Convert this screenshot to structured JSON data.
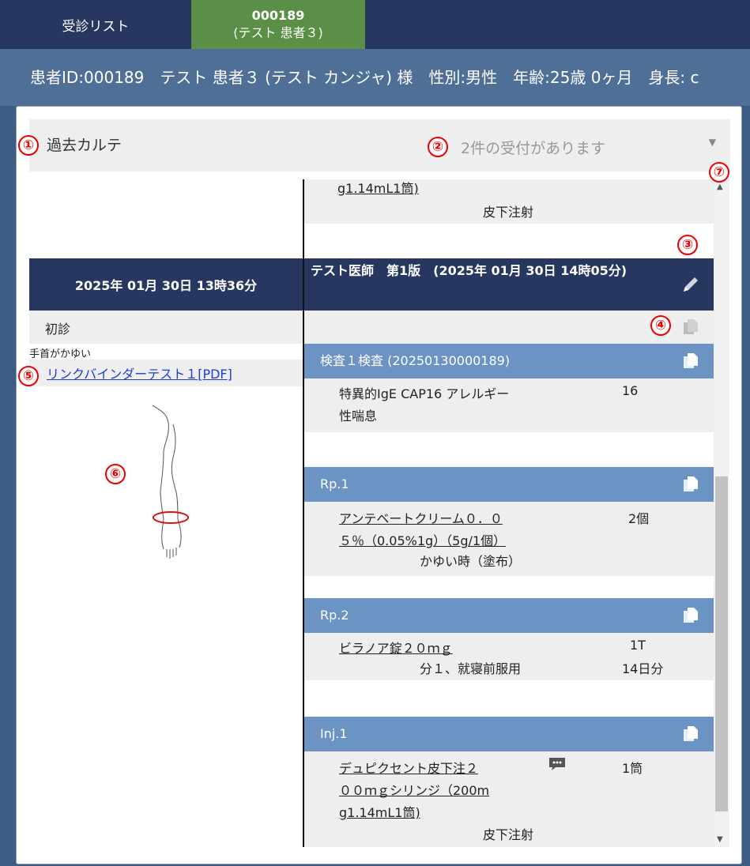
{
  "tabs": {
    "list_label": "受診リスト",
    "active_id": "000189",
    "active_name": "(テスト 患者３)"
  },
  "patient_info": "患者ID:000189　テスト 患者３ (テスト カンジャ) 様　性別:男性　年齢:25歳 0ヶ月　身長: c",
  "select": {
    "title": "過去カルテ",
    "placeholder": "2件の受付があります"
  },
  "markers": [
    "①",
    "②",
    "③",
    "④",
    "⑤",
    "⑥",
    "⑦"
  ],
  "top_carryover": {
    "drug_tail": "g1.14mL1筒)",
    "route": "皮下注射"
  },
  "visit": {
    "date": "2025年 01月 30日 13時36分",
    "doctor": "テスト医師　第1版　(2025年 01月 30日 14時05分)",
    "visit_type": "初診",
    "complaint": "手首がかゆい",
    "link": "リンクバインダーテスト１[PDF]"
  },
  "sections": [
    {
      "header": "検査１検査 (20250130000189)",
      "lines": [
        "特異的IgE CAP16 アレルギー",
        "性喘息"
      ],
      "value": "16"
    },
    {
      "header": "Rp.1",
      "lines": [
        "アンテベートクリーム０．０",
        "５％（0.05%1g）（5g/1個）"
      ],
      "value": "2個",
      "usage": "かゆい時（塗布）"
    },
    {
      "header": "Rp.2",
      "lines": [
        "ビラノア錠２０ｍｇ"
      ],
      "value": "1T",
      "usage": "分１、就寝前服用",
      "days": "14日分"
    },
    {
      "header": "Inj.1",
      "lines": [
        "デュピクセント皮下注２",
        "００ｍｇシリンジ（200m",
        "g1.14mL1筒)"
      ],
      "value": "1筒",
      "usage": "皮下注射"
    }
  ],
  "colors": {
    "tabbar": "#27375f",
    "active_tab": "#5b8f47",
    "infobar": "#4f6f97",
    "section_header": "#6b93c4",
    "marker": "#ee0000"
  },
  "icons": [
    "pencil-icon",
    "copy-icon",
    "comment-icon",
    "chevron-down-icon",
    "scroll-up-icon",
    "scroll-down-icon"
  ]
}
